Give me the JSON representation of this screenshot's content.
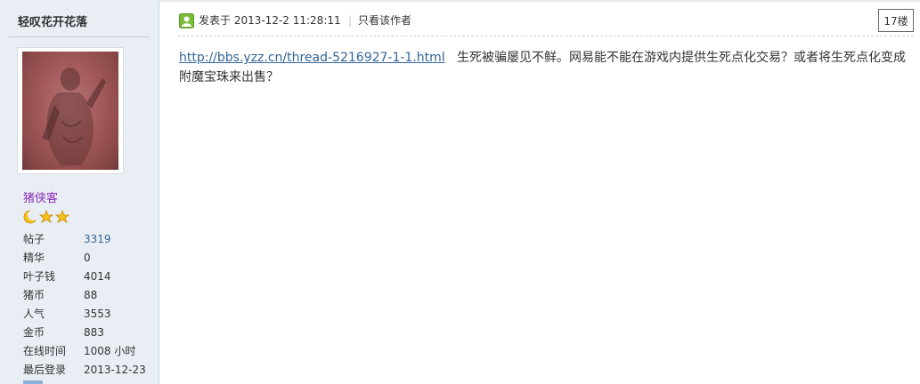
{
  "user": {
    "name": "轻叹花开花落",
    "group": "猪侠客",
    "stats": [
      {
        "label": "帖子",
        "value": "3319",
        "link": true
      },
      {
        "label": "精华",
        "value": "0",
        "link": false
      },
      {
        "label": "叶子钱",
        "value": "4014",
        "link": false
      },
      {
        "label": "猪币",
        "value": "88",
        "link": false
      },
      {
        "label": "人气",
        "value": "3553",
        "link": false
      },
      {
        "label": "金币",
        "value": "883",
        "link": false
      },
      {
        "label": "在线时间",
        "value": "1008 小时",
        "link": false
      },
      {
        "label": "最后登录",
        "value": "2013-12-23",
        "link": false
      }
    ],
    "rank_icons": [
      "moon-icon",
      "star-icon",
      "star-icon"
    ]
  },
  "post": {
    "posted_at": "发表于 2013-12-2 11:28:11",
    "separator": "|",
    "only_author": "只看该作者",
    "floor": "17楼",
    "link_text": "http://bbs.yzz.cn/thread-5216927-1-1.html",
    "body_text": "生死被骗屡见不鲜。网易能不能在游戏内提供生死点化交易？或者将生死点化变成附魔宝珠来出售？"
  },
  "colors": {
    "sidebar_bg": "#e9eef4",
    "link": "#336699",
    "group": "#8a2bb8",
    "icon_green": "#7cba3a"
  }
}
